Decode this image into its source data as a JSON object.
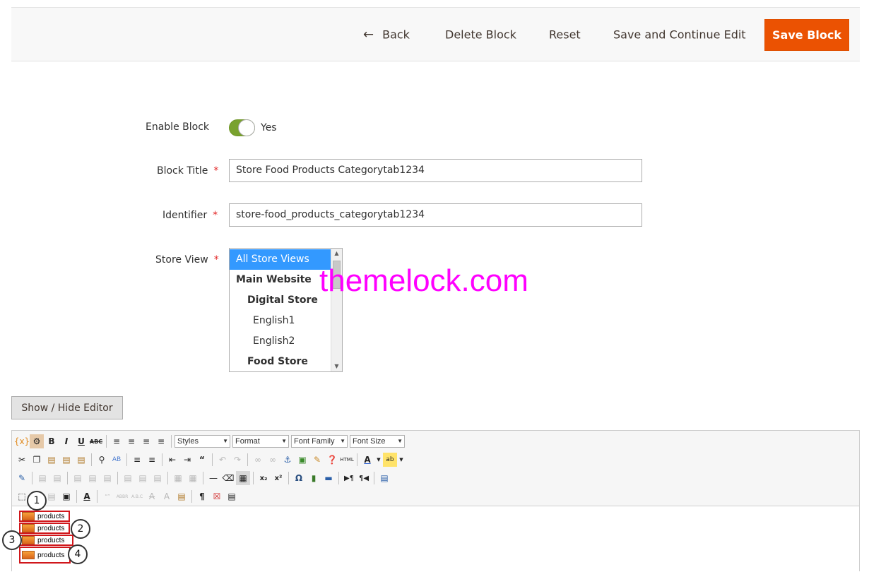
{
  "actions": {
    "back": "Back",
    "delete": "Delete Block",
    "reset": "Reset",
    "save_continue": "Save and Continue Edit",
    "save": "Save Block"
  },
  "form": {
    "enable_label": "Enable Block",
    "enable_value": "Yes",
    "title_label": "Block Title",
    "title_value": "Store Food Products Categorytab1234",
    "identifier_label": "Identifier",
    "identifier_value": "store-food_products_categorytab1234",
    "store_view_label": "Store View",
    "required_mark": "*",
    "store_view_options": [
      {
        "label": "All Store Views",
        "selected": true
      },
      {
        "label": "Main Website"
      },
      {
        "label": "Digital Store"
      },
      {
        "label": "English1"
      },
      {
        "label": "English2"
      },
      {
        "label": "Food Store"
      }
    ]
  },
  "watermark": "themelock.com",
  "editor": {
    "show_hide": "Show / Hide Editor",
    "dropdowns": [
      "Styles",
      "Format",
      "Font Family",
      "Font Size"
    ],
    "widgets": [
      "products",
      "products",
      "products",
      "products"
    ],
    "callouts": [
      "1",
      "2",
      "3",
      "4"
    ]
  },
  "colors": {
    "primary_button": "#eb5202",
    "toggle_on": "#79a22e",
    "selected_option": "#3399ff",
    "watermark": "#ff00ff",
    "widget_border": "#d0171b"
  }
}
